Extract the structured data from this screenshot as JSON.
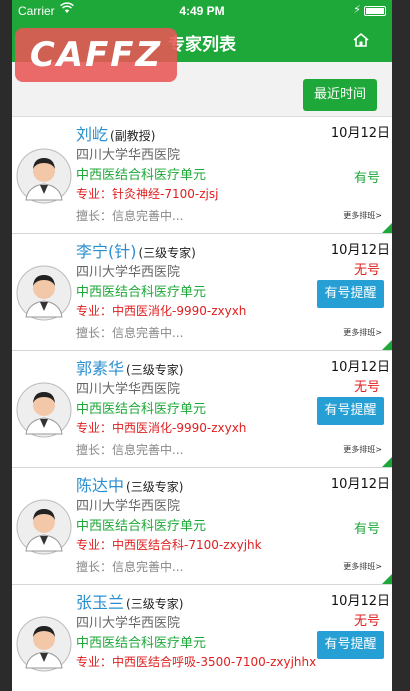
{
  "statusbar": {
    "carrier": "Carrier",
    "time": "4:49 PM"
  },
  "nav": {
    "title": "专家列表",
    "logo_text": "CAFFZ"
  },
  "filter": {
    "recent_label": "最近时间"
  },
  "colors": {
    "brand_green": "#1ea839",
    "name_blue": "#2a8fd0",
    "alert_red": "#e02020",
    "button_blue": "#259fd4"
  },
  "doctors": [
    {
      "name": "刘屹",
      "title": "(副教授)",
      "hospital": "四川大学华西医院",
      "dept": "中西医结合科医疗单元",
      "spec": "专业：针灸神经-7100-zjsj",
      "skill": "擅长：信息完善中...",
      "date": "10月12日",
      "status": "有号",
      "more": "更多排班>"
    },
    {
      "name": "李宁(针)",
      "title": "(三级专家)",
      "hospital": "四川大学华西医院",
      "dept": "中西医结合科医疗单元",
      "spec": "专业：中西医消化-9990-zxyxh",
      "skill": "擅长：信息完善中...",
      "date": "10月12日",
      "status": "无号",
      "button": "有号提醒",
      "more": "更多排班>"
    },
    {
      "name": "郭素华",
      "title": "(三级专家)",
      "hospital": "四川大学华西医院",
      "dept": "中西医结合科医疗单元",
      "spec": "专业：中西医消化-9990-zxyxh",
      "skill": "擅长：信息完善中...",
      "date": "10月12日",
      "status": "无号",
      "button": "有号提醒",
      "more": "更多排班>"
    },
    {
      "name": "陈达中",
      "title": "(三级专家)",
      "hospital": "四川大学华西医院",
      "dept": "中西医结合科医疗单元",
      "spec": "专业：中西医结合科-7100-zxyjhk",
      "skill": "擅长：信息完善中...",
      "date": "10月12日",
      "status": "有号",
      "more": "更多排班>"
    },
    {
      "name": "张玉兰",
      "title": "(三级专家)",
      "hospital": "四川大学华西医院",
      "dept": "中西医结合科医疗单元",
      "spec": "专业：中西医结合呼吸-3500-7100-zxyjhhx",
      "date": "10月12日",
      "status": "无号",
      "button": "有号提醒"
    }
  ]
}
